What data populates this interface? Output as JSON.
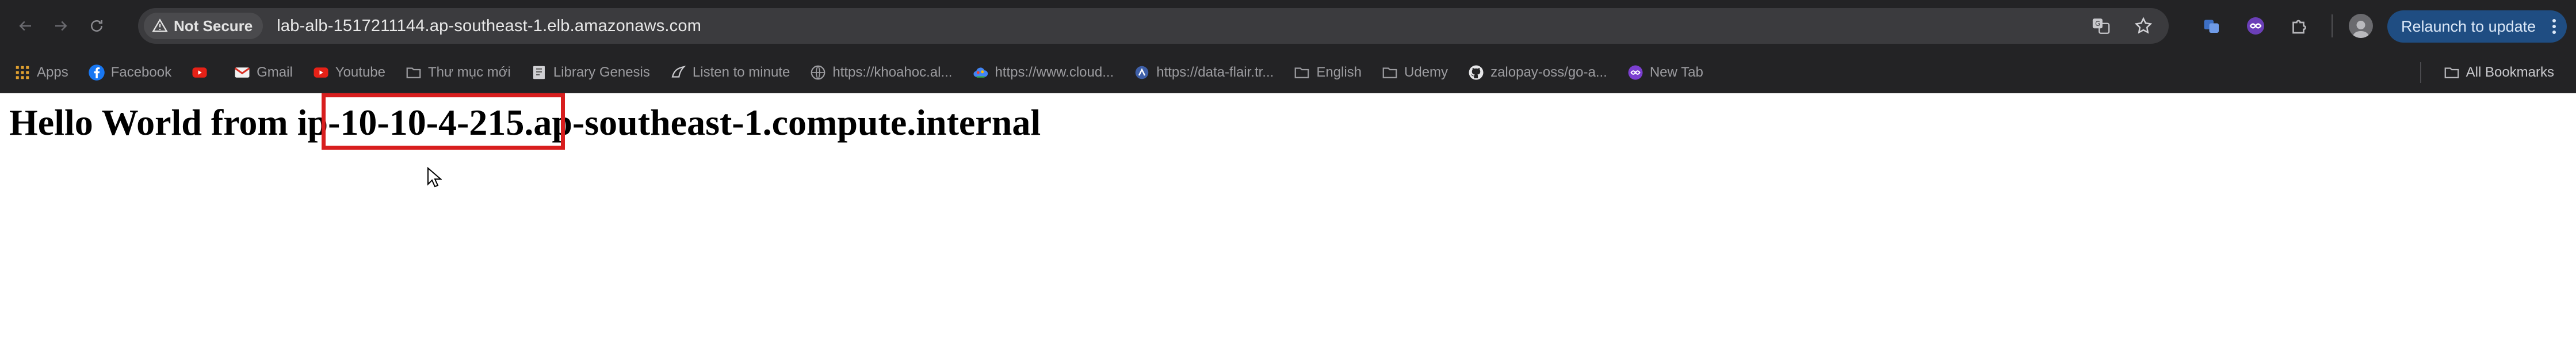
{
  "browser": {
    "security_label": "Not Secure",
    "url": "lab-alb-1517211144.ap-southeast-1.elb.amazonaws.com",
    "relaunch_label": "Relaunch to update",
    "accent_color": "#1f4d82"
  },
  "bookmarks": {
    "items": [
      {
        "label": "Apps",
        "icon": "apps-grid-icon"
      },
      {
        "label": "Facebook",
        "icon": "facebook-icon"
      },
      {
        "label": "",
        "icon": "youtube-icon"
      },
      {
        "label": "Gmail",
        "icon": "gmail-icon"
      },
      {
        "label": "Youtube",
        "icon": "youtube-icon"
      },
      {
        "label": "Thư mục mới",
        "icon": "folder-icon"
      },
      {
        "label": "Library Genesis",
        "icon": "library-icon"
      },
      {
        "label": "Listen to minute",
        "icon": "listen-icon"
      },
      {
        "label": "https://khoahoc.al...",
        "icon": "globe-icon"
      },
      {
        "label": "https://www.cloud...",
        "icon": "cloud-icon"
      },
      {
        "label": "https://data-flair.tr...",
        "icon": "dataflair-icon"
      },
      {
        "label": "English",
        "icon": "folder-icon"
      },
      {
        "label": "Udemy",
        "icon": "folder-icon"
      },
      {
        "label": "zalopay-oss/go-a...",
        "icon": "github-icon"
      },
      {
        "label": "New Tab",
        "icon": "newtab-icon"
      }
    ],
    "all_bookmarks": "All Bookmarks"
  },
  "page": {
    "heading": "Hello World from ip-10-10-4-215.ap-southeast-1.compute.internal",
    "highlight_color": "#d81e1e"
  }
}
